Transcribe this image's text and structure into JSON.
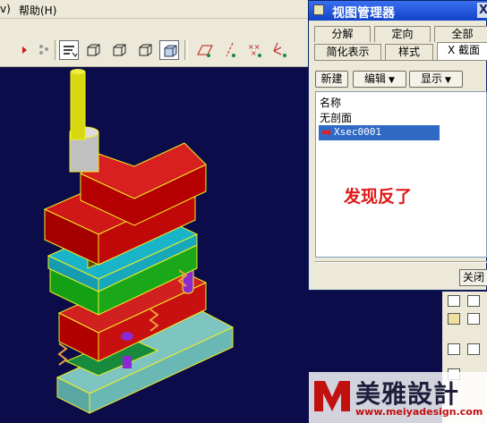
{
  "menubar": {
    "item_left": "v)",
    "help": "帮助(H)"
  },
  "dialog": {
    "title": "视图管理器",
    "close_glyph": "X",
    "tabs_row1": [
      "分解",
      "定向",
      "全部"
    ],
    "tabs_row2": [
      "简化表示",
      "样式",
      "X 截面"
    ],
    "active_tab": "X 截面",
    "buttons": {
      "new": "新建",
      "edit": "编辑",
      "display": "显示"
    },
    "list": {
      "header": "名称",
      "items": [
        "无剖面",
        "Xsec0001"
      ],
      "selected": "Xsec0001"
    },
    "close_button": "关闭"
  },
  "annotation": "发现反了",
  "watermark": {
    "text": "美雅設計",
    "url": "www.meiyadesign.com"
  },
  "colors": {
    "background": "#0c0c4a",
    "titlebar": "#1a4fd8",
    "selection": "#316ac5",
    "annotation": "#e01818",
    "plate_red": "#b00000",
    "plate_green": "#1aa81a",
    "plate_cyan": "#1ab4c8",
    "plate_teal": "#7ec4c0",
    "pin_yellow": "#d8d810",
    "edge_yellow": "#f0f020"
  },
  "icons": [
    "arrow-icon",
    "datum-icon",
    "repaint-icon",
    "wireframe-icon",
    "hidden-line-icon",
    "no-hidden-icon",
    "shaded-icon",
    "datum-plane-icon",
    "datum-axis-icon",
    "datum-point-icon",
    "coord-sys-icon",
    "view-manager-icon"
  ]
}
